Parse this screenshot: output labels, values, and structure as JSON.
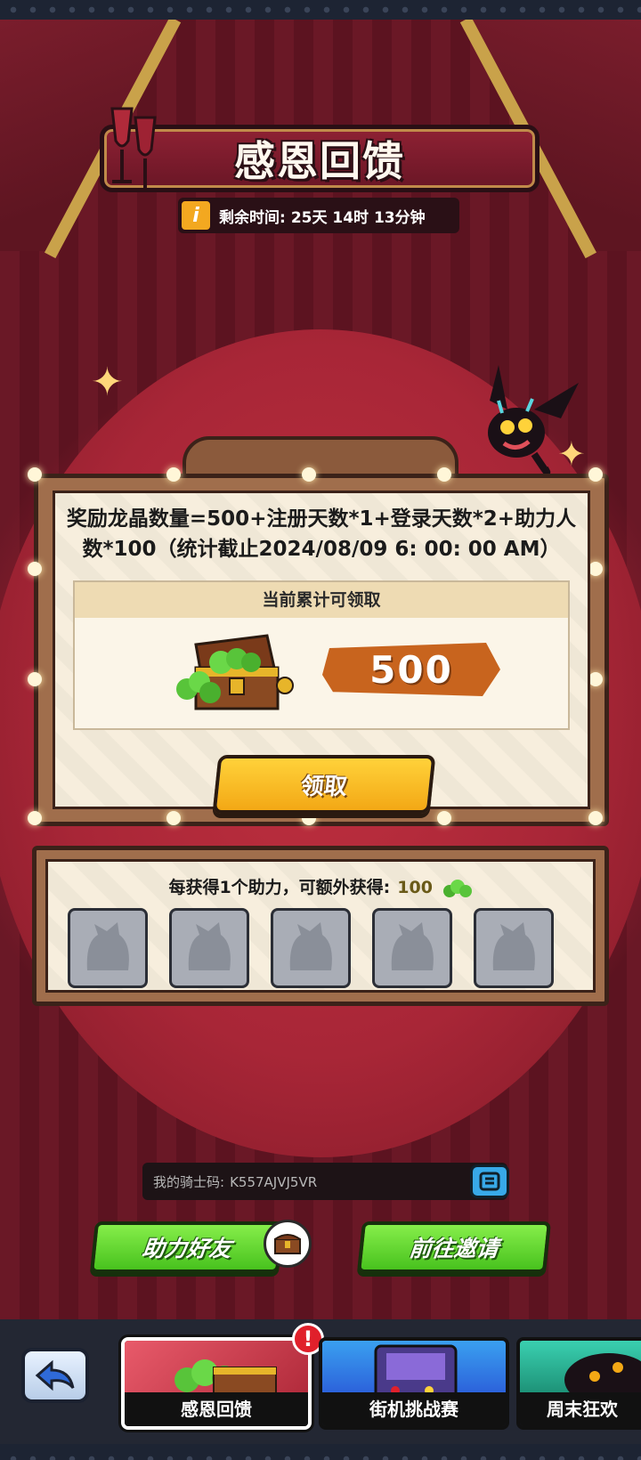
{
  "header": {
    "title": "感恩回馈",
    "timer_label": "剩余时间:",
    "timer_value": "25天 14时 13分钟"
  },
  "reward": {
    "formula": "奖励龙晶数量=500+注册天数*1+登录天数*2+助力人数*100（统计截止2024/08/09 6: 00: 00 AM）",
    "panel_title": "当前累计可领取",
    "amount": "500",
    "claim_label": "领取"
  },
  "helpers": {
    "bonus_text": "每获得1个助力，可额外获得:",
    "bonus_amount": "100",
    "slots": [
      "",
      "",
      "",
      "",
      ""
    ]
  },
  "knight_code": {
    "label": "我的骑士码:",
    "value": "K557AJVJ5VR"
  },
  "actions": {
    "assist_friend": "助力好友",
    "go_invite": "前往邀请"
  },
  "tabs": [
    {
      "label": "感恩回馈",
      "active": true
    },
    {
      "label": "街机挑战赛",
      "active": false
    },
    {
      "label": "周末狂欢",
      "active": false
    }
  ],
  "alert_badge": "!",
  "icons": {
    "info": "info-icon",
    "copy": "copy-icon",
    "back": "back-arrow-icon",
    "gem": "green-gem-icon"
  },
  "colors": {
    "accent_gold": "#f3a815",
    "accent_green": "#48c21e",
    "stage_red": "#a82637",
    "ribbon_orange": "#c8641e"
  }
}
